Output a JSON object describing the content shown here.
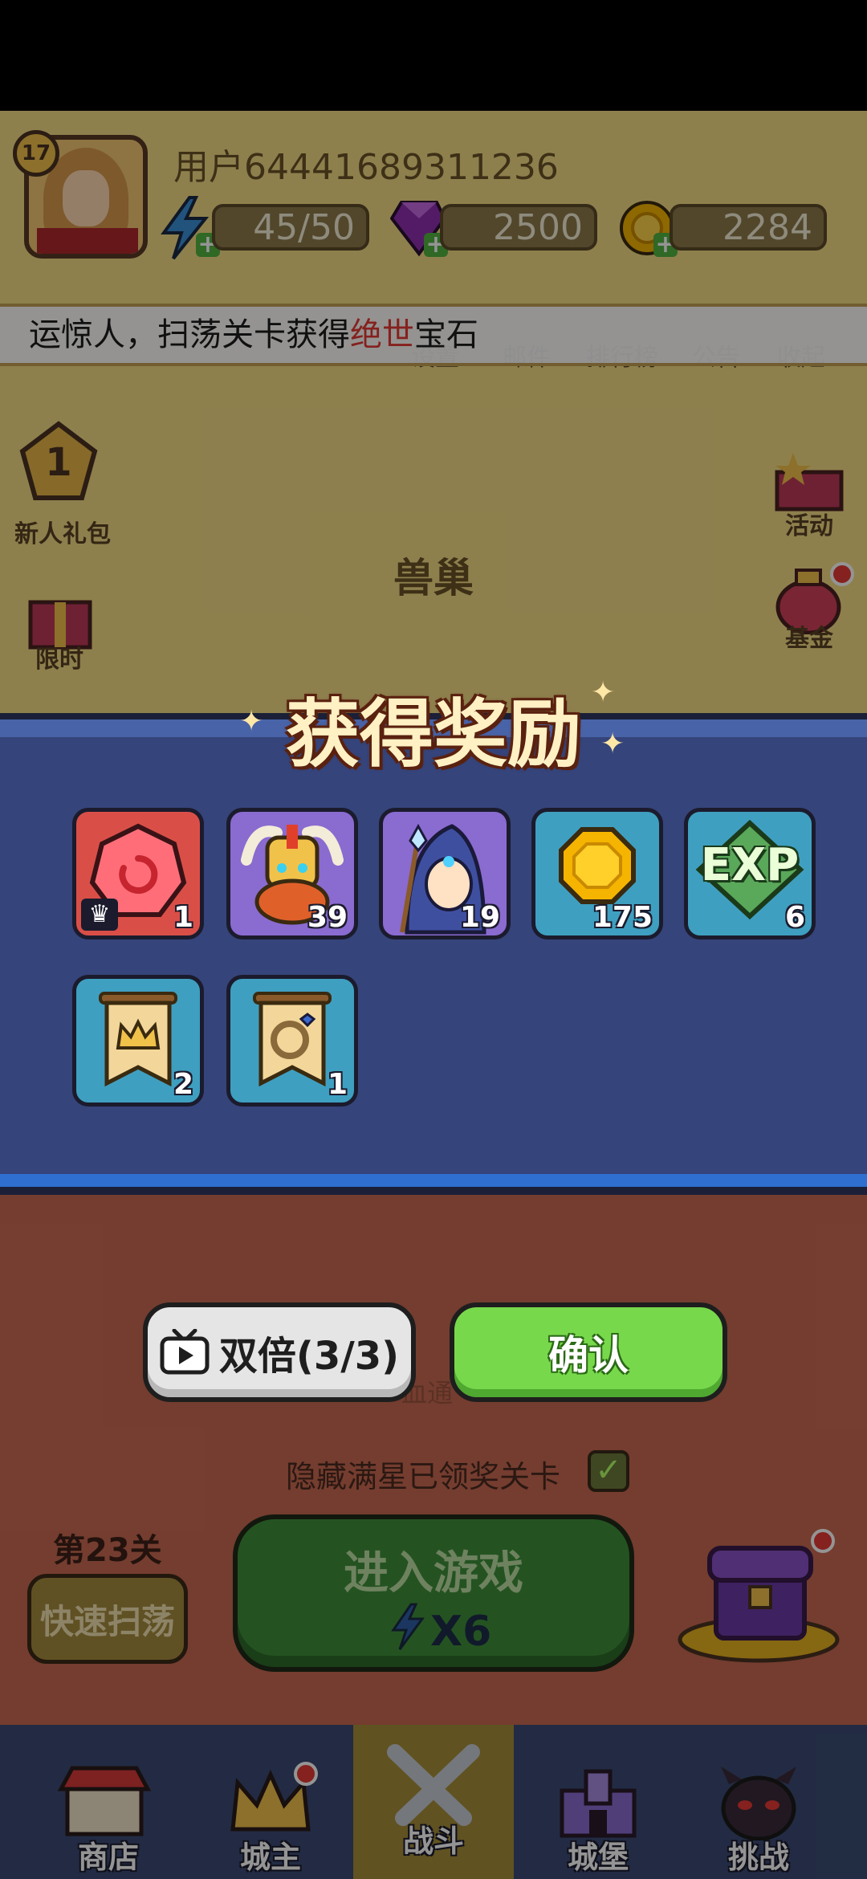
{
  "player": {
    "level": "17",
    "username": "用户64441689311236"
  },
  "resources": {
    "energy": "45/50",
    "gems": "2500",
    "gold": "2284"
  },
  "marquee": {
    "text_before": "运惊人，扫荡关卡获得",
    "text_highlight": "绝世",
    "text_after": "宝石"
  },
  "top_menu": [
    "设置",
    "邮件",
    "排行榜",
    "公告",
    "收起"
  ],
  "left_side": {
    "newbie_pack": "新人礼包",
    "newbie_number": "1",
    "limited": "限时"
  },
  "right_side": {
    "activity": "活动",
    "fund": "基金"
  },
  "scene_title": "兽巢",
  "modal": {
    "title": "获得奖励",
    "items": [
      {
        "icon": "red-gem-icon",
        "count": "1",
        "badge": "crown"
      },
      {
        "icon": "viking-hero-icon",
        "count": "39"
      },
      {
        "icon": "mage-hero-icon",
        "count": "19"
      },
      {
        "icon": "gold-coin-icon",
        "count": "175"
      },
      {
        "icon": "exp-icon",
        "count": "6",
        "text": "EXP"
      },
      {
        "icon": "crown-banner-icon",
        "count": "2"
      },
      {
        "icon": "ring-banner-icon",
        "count": "1"
      }
    ]
  },
  "buttons": {
    "double": "双倍(3/3)",
    "confirm": "确认",
    "enter_game": "进入游戏",
    "enter_cost": "X6",
    "quick_sweep": "快速扫荡"
  },
  "hidden_stars_label": "隐藏满星已领奖关卡",
  "stage_label": "第23关",
  "bg_behind": "血通",
  "tabs": [
    "商店",
    "城主",
    "战斗",
    "城堡",
    "挑战"
  ],
  "colors": {
    "modal_bg": "#35447a",
    "confirm_green": "#78d84b",
    "highlight_red": "#e53935",
    "scene_yellow": "#f4dc86"
  }
}
